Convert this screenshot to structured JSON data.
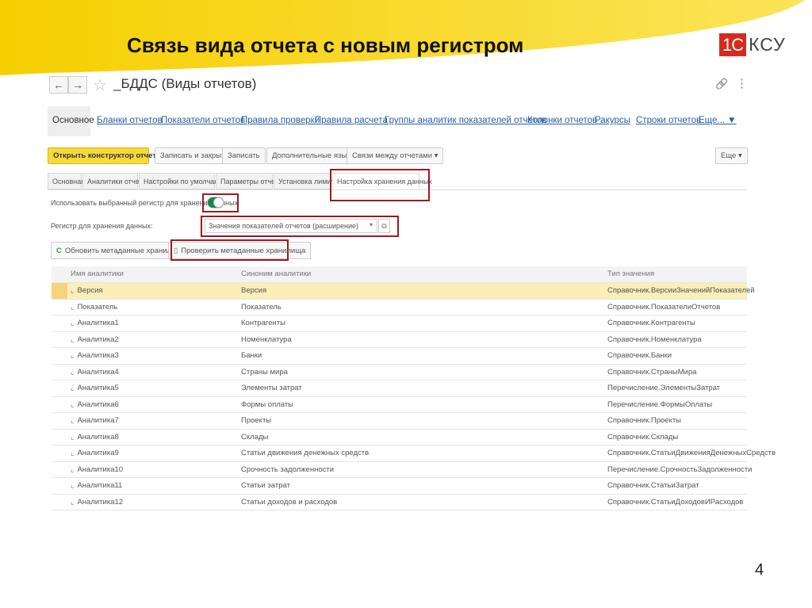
{
  "slide": {
    "title": "Связь вида отчета с новым регистром",
    "page_number": "4",
    "logo": {
      "part1": "1С",
      "part2": "КСУ"
    },
    "accent": "#f7d100"
  },
  "window": {
    "title": "_БДДС (Виды отчетов)",
    "back_icon": "←",
    "forward_icon": "→",
    "star_icon": "☆",
    "link_icon": "🔗",
    "more_icon": "⋮"
  },
  "nav": {
    "current": "Основное",
    "links": [
      "Бланки отчетов",
      "Показатели отчетов",
      "Правила проверки",
      "Правила расчета",
      "Группы аналитик показателей отчетов",
      "Колонки отчетов",
      "Ракурсы",
      "Строки отчетов",
      "Еще... ▼"
    ]
  },
  "toolbar": {
    "open_constructor": "Открыть конструктор отчета",
    "save_close": "Записать и закрыть",
    "save": "Записать",
    "languages": "Дополнительные языки ▾",
    "relations": "Связи между отчетами ▾",
    "more": "Еще ▾"
  },
  "tabs": [
    "Основная",
    "Аналитики отчета",
    "Настройки по умолчанию",
    "Параметры отчета",
    "Установка лимитов",
    "Настройка хранения данных"
  ],
  "form": {
    "use_register_label": "Использовать выбранный регистр для хранения данных",
    "use_register_on": true,
    "register_label": "Регистр для хранения данных:",
    "register_value": "Значения показателей отчетов (расширение)",
    "refresh_button": "Обновить метаданные хранилища",
    "check_button": "Проверить метаданные хранилища"
  },
  "table": {
    "columns": [
      "Имя аналитики",
      "Синоним аналитики",
      "Тип значения"
    ],
    "rows": [
      [
        "Версия",
        "Версия",
        "Справочник.ВерсииЗначенийПоказателей"
      ],
      [
        "Показатель",
        "Показатель",
        "Справочник.ПоказателиОтчетов"
      ],
      [
        "Аналитика1",
        "Контрагенты",
        "Справочник.Контрагенты"
      ],
      [
        "Аналитика2",
        "Номенклатура",
        "Справочник.Номенклатура"
      ],
      [
        "Аналитика3",
        "Банки",
        "Справочник.Банки"
      ],
      [
        "Аналитика4",
        "Страны мира",
        "Справочник.СтраныМира"
      ],
      [
        "Аналитика5",
        "Элементы затрат",
        "Перечисление.ЭлементыЗатрат"
      ],
      [
        "Аналитика6",
        "Формы оплаты",
        "Перечисление.ФормыОплаты"
      ],
      [
        "Аналитика7",
        "Проекты",
        "Справочник.Проекты"
      ],
      [
        "Аналитика8",
        "Склады",
        "Справочник.Склады"
      ],
      [
        "Аналитика9",
        "Статьи движения денежных средств",
        "Справочник.СтатьиДвиженияДенежныхСредств"
      ],
      [
        "Аналитика10",
        "Срочность задолженности",
        "Перечисление.СрочностьЗадолженности"
      ],
      [
        "Аналитика11",
        "Статьи затрат",
        "Справочник.СтатьиЗатрат"
      ],
      [
        "Аналитика12",
        "Статьи доходов и расходов",
        "Справочник.СтатьиДоходовИРасходов"
      ]
    ]
  }
}
